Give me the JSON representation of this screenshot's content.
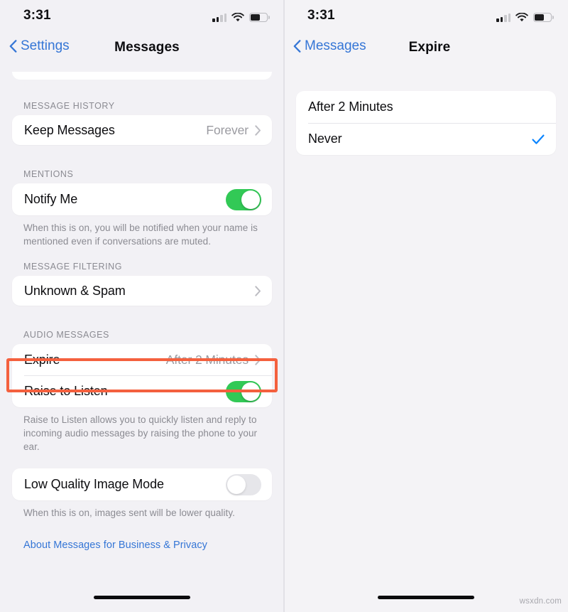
{
  "watermark": "wsxdn.com",
  "status_bar": {
    "time": "3:31",
    "signal_bars_filled": 2,
    "signal_bars_total": 4,
    "wifi": "wifi-icon",
    "battery": "battery-icon"
  },
  "accent": {
    "blue": "#3576d6",
    "green": "#32c956",
    "annotation_red": "#f4603e",
    "check_blue": "#0a84ff"
  },
  "left_panel": {
    "nav": {
      "back_label": "Settings",
      "title": "Messages",
      "back_icon": "chevron-left-icon"
    },
    "sections": [
      {
        "header": "MESSAGE HISTORY",
        "rows": [
          {
            "label": "Keep Messages",
            "value": "Forever",
            "type": "disclosure"
          }
        ]
      },
      {
        "header": "MENTIONS",
        "rows": [
          {
            "label": "Notify Me",
            "type": "switch",
            "state": "on"
          }
        ],
        "footnote": "When this is on, you will be notified when your name is mentioned even if conversations are muted."
      },
      {
        "header": "MESSAGE FILTERING",
        "rows": [
          {
            "label": "Unknown & Spam",
            "value": "",
            "type": "disclosure"
          }
        ]
      },
      {
        "header": "AUDIO MESSAGES",
        "rows": [
          {
            "label": "Expire",
            "value": "After 2 Minutes",
            "type": "disclosure",
            "highlighted": true
          },
          {
            "label": "Raise to Listen",
            "type": "switch",
            "state": "on"
          }
        ],
        "footnote": "Raise to Listen allows you to quickly listen and reply to incoming audio messages by raising the phone to your ear."
      },
      {
        "header": "",
        "rows": [
          {
            "label": "Low Quality Image Mode",
            "type": "switch",
            "state": "off"
          }
        ],
        "footnote": "When this is on, images sent will be lower quality."
      }
    ],
    "link": "About Messages for Business & Privacy"
  },
  "right_panel": {
    "nav": {
      "back_label": "Messages",
      "title": "Expire",
      "back_icon": "chevron-left-icon"
    },
    "options": [
      {
        "label": "After 2 Minutes",
        "selected": false
      },
      {
        "label": "Never",
        "selected": true
      }
    ]
  }
}
